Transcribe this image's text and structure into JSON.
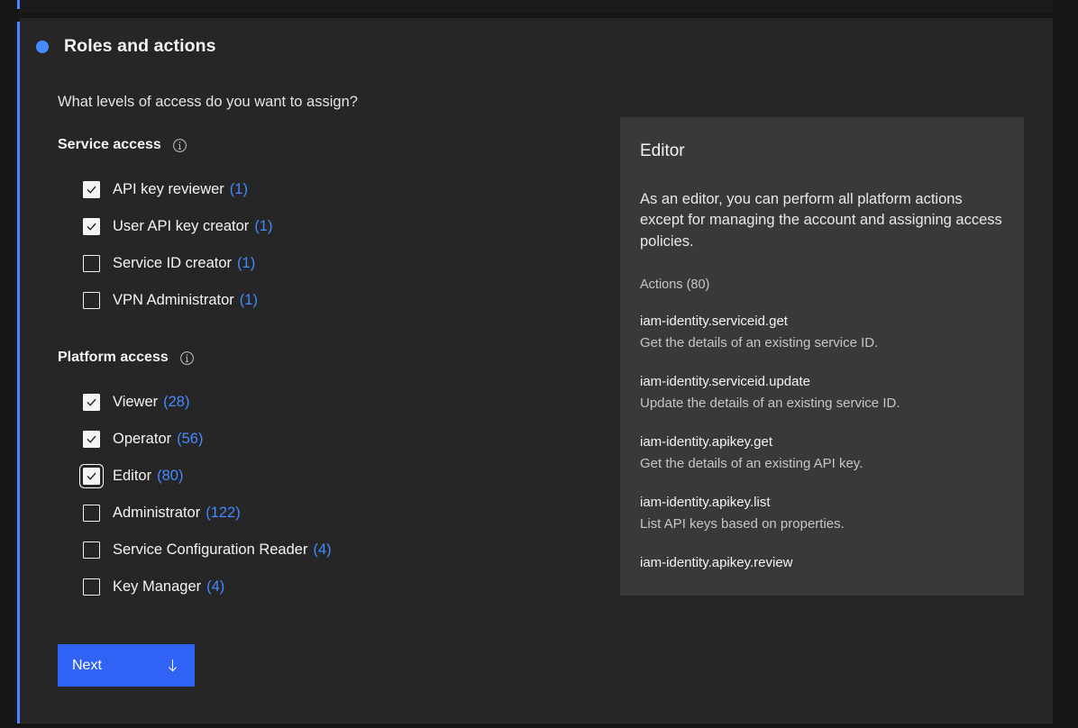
{
  "step": {
    "title": "Roles and actions",
    "subtitle": "What levels of access do you want to assign?"
  },
  "groups": [
    {
      "heading": "Service access",
      "info_icon": "info-circle-icon",
      "items": [
        {
          "label": "API key reviewer",
          "count": "(1)",
          "checked": true,
          "focused": false
        },
        {
          "label": "User API key creator",
          "count": "(1)",
          "checked": true,
          "focused": false
        },
        {
          "label": "Service ID creator",
          "count": "(1)",
          "checked": false,
          "focused": false
        },
        {
          "label": "VPN Administrator",
          "count": "(1)",
          "checked": false,
          "focused": false
        }
      ]
    },
    {
      "heading": "Platform access",
      "info_icon": "info-circle-icon",
      "items": [
        {
          "label": "Viewer",
          "count": "(28)",
          "checked": true,
          "focused": false
        },
        {
          "label": "Operator",
          "count": "(56)",
          "checked": true,
          "focused": false
        },
        {
          "label": "Editor",
          "count": "(80)",
          "checked": true,
          "focused": true
        },
        {
          "label": "Administrator",
          "count": "(122)",
          "checked": false,
          "focused": false
        },
        {
          "label": "Service Configuration Reader",
          "count": "(4)",
          "checked": false,
          "focused": false
        },
        {
          "label": "Key Manager",
          "count": "(4)",
          "checked": false,
          "focused": false
        }
      ]
    }
  ],
  "details": {
    "title": "Editor",
    "description": "As an editor, you can perform all platform actions except for managing the account and assigning access policies.",
    "actions_label": "Actions (80)",
    "actions": [
      {
        "name": "iam-identity.serviceid.get",
        "desc": "Get the details of an existing service ID."
      },
      {
        "name": "iam-identity.serviceid.update",
        "desc": "Update the details of an existing service ID."
      },
      {
        "name": "iam-identity.apikey.get",
        "desc": "Get the details of an existing API key."
      },
      {
        "name": "iam-identity.apikey.list",
        "desc": "List API keys based on properties."
      },
      {
        "name": "iam-identity.apikey.review",
        "desc": ""
      }
    ]
  },
  "footer": {
    "next_label": "Next",
    "next_icon": "arrow-down-icon"
  },
  "colors": {
    "accent": "#4589ff",
    "button": "#2f62f5",
    "card_bg": "#262626",
    "panel_bg": "#393939",
    "page_bg": "#161616",
    "text": "#f4f4f4",
    "text_muted": "#c6c6c6"
  }
}
